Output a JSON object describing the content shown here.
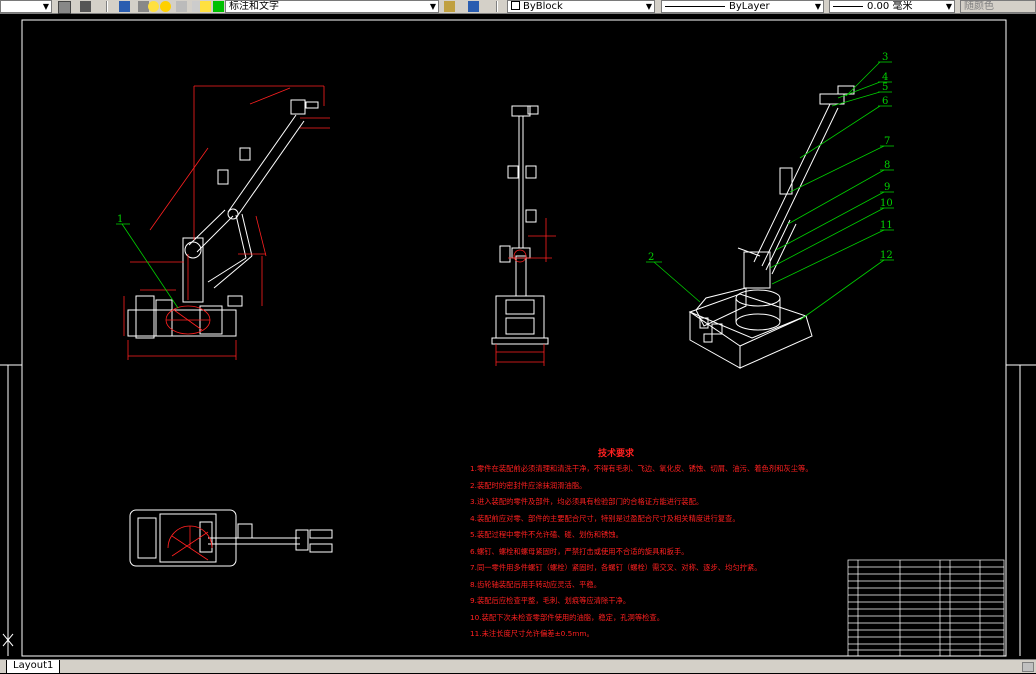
{
  "toolbar": {
    "layer_combo": "标注和文字",
    "color_combo": "ByBlock",
    "linetype_combo": "ByLayer",
    "lineweight_combo": "0.00 毫米",
    "plotstyle_combo": "随颜色"
  },
  "drawing": {
    "balloons": [
      "1",
      "2",
      "3",
      "4",
      "5",
      "6",
      "7",
      "8",
      "9",
      "10",
      "11",
      "12"
    ],
    "tech_title": "技术要求",
    "tech_items": [
      "1.零件在装配前必须清理和清洗干净，不得有毛刺、飞边、氧化皮、锈蚀、切屑、油污、着色剂和灰尘等。",
      "2.装配时的密封件应涂抹润滑油脂。",
      "3.进入装配的零件及部件，均必须具有检验部门的合格证方能进行装配。",
      "4.装配前应对零、部件的主要配合尺寸，特别是过盈配合尺寸及相关精度进行复查。",
      "5.装配过程中零件不允许磕、碰、划伤和锈蚀。",
      "6.螺钉、螺栓和螺母紧固时，严禁打击或使用不合适的旋具和扳手。",
      "7.同一零件用多件螺钉（螺栓）紧固时，各螺钉（螺栓）需交叉、对称、逐步、均匀拧紧。",
      "8.齿轮轴装配后用手转动应灵活、平稳。",
      "9.装配后应检查平整，毛刺、划痕等应清除干净。",
      "10.装配下次未检查零部件使用的油脂，稳定，孔洞等检查。",
      "11.未注长度尺寸允许偏差±0.5mm。"
    ]
  },
  "status": {
    "layout_tab": "Layout1"
  }
}
